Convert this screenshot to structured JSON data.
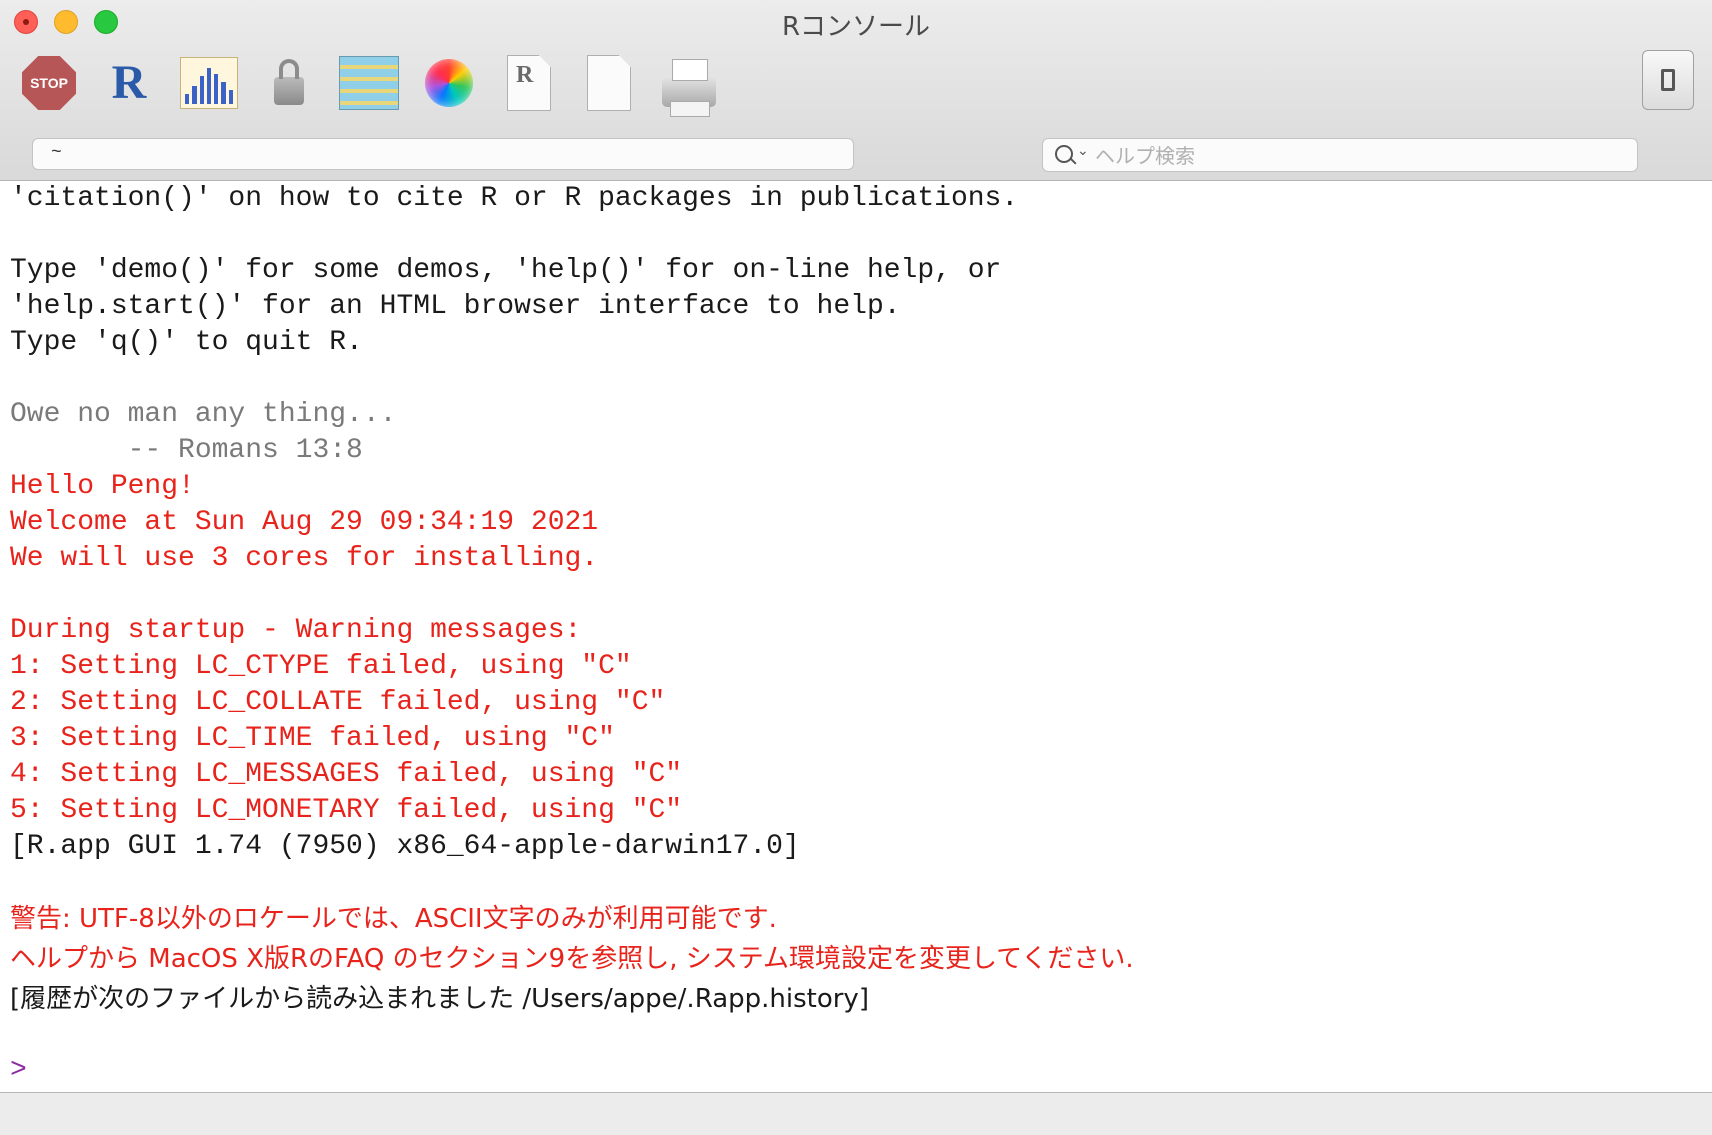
{
  "window": {
    "title": "Rコンソール"
  },
  "toolbar": {
    "stop_label": "STOP",
    "buttons": [
      {
        "name": "stop-icon"
      },
      {
        "name": "r-source-icon"
      },
      {
        "name": "quartz-chart-icon"
      },
      {
        "name": "lock-icon"
      },
      {
        "name": "data-table-icon"
      },
      {
        "name": "color-wheel-icon"
      },
      {
        "name": "r-document-icon"
      },
      {
        "name": "new-document-icon"
      },
      {
        "name": "printer-icon"
      }
    ]
  },
  "path_field": {
    "value": "~"
  },
  "search": {
    "placeholder": "ヘルプ検索"
  },
  "console": {
    "lines": [
      {
        "text": "'citation()' on how to cite R or R packages in publications.",
        "color": "black"
      },
      {
        "text": "",
        "color": "black"
      },
      {
        "text": "Type 'demo()' for some demos, 'help()' for on-line help, or",
        "color": "black"
      },
      {
        "text": "'help.start()' for an HTML browser interface to help.",
        "color": "black"
      },
      {
        "text": "Type 'q()' to quit R.",
        "color": "black"
      },
      {
        "text": "",
        "color": "black"
      },
      {
        "text": "Owe no man any thing...",
        "color": "gray"
      },
      {
        "text": "       -- Romans 13:8",
        "color": "gray"
      },
      {
        "text": "Hello Peng!",
        "color": "red"
      },
      {
        "text": "Welcome at Sun Aug 29 09:34:19 2021",
        "color": "red"
      },
      {
        "text": "We will use 3 cores for installing.",
        "color": "red"
      },
      {
        "text": "",
        "color": "red"
      },
      {
        "text": "During startup - Warning messages:",
        "color": "red"
      },
      {
        "text": "1: Setting LC_CTYPE failed, using \"C\"",
        "color": "red"
      },
      {
        "text": "2: Setting LC_COLLATE failed, using \"C\"",
        "color": "red"
      },
      {
        "text": "3: Setting LC_TIME failed, using \"C\"",
        "color": "red"
      },
      {
        "text": "4: Setting LC_MESSAGES failed, using \"C\"",
        "color": "red"
      },
      {
        "text": "5: Setting LC_MONETARY failed, using \"C\"",
        "color": "red"
      },
      {
        "text": "[R.app GUI 1.74 (7950) x86_64-apple-darwin17.0]",
        "color": "black"
      },
      {
        "text": "",
        "color": "black"
      },
      {
        "text": "警告: UTF-8以外のロケールでは、ASCII文字のみが利用可能です.",
        "color": "red"
      },
      {
        "text": "ヘルプから MacOS X版RのFAQ のセクション9を参照し, システム環境設定を変更してください.",
        "color": "red"
      },
      {
        "text": "[履歴が次のファイルから読み込まれました /Users/appe/.Rapp.history]",
        "color": "black"
      },
      {
        "text": "",
        "color": "black"
      }
    ],
    "prompt": ">"
  },
  "colors": {
    "output_black": "#1a1a1a",
    "startup_gray": "#7a7a7a",
    "warning_red": "#e8231b",
    "prompt_purple": "#8a2aa0"
  }
}
